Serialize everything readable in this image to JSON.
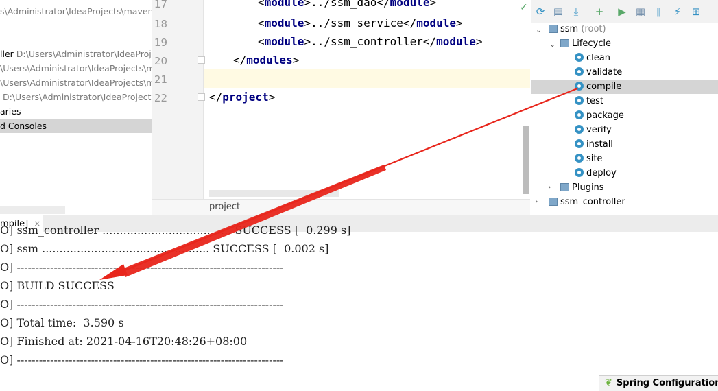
{
  "project_tree": [
    {
      "label": "",
      "path": "s\\Administrator\\IdeaProjects\\maven_a",
      "selected": false
    },
    {
      "label": "ller",
      "path": "D:\\Users\\Administrator\\IdeaProjec",
      "selected": false
    },
    {
      "label": "",
      "path": "\\Users\\Administrator\\IdeaProjects\\mav",
      "selected": false
    },
    {
      "label": "",
      "path": "\\Users\\Administrator\\IdeaProjects\\ma",
      "selected": false
    },
    {
      "label": "",
      "path": "D:\\Users\\Administrator\\IdeaProjects\\",
      "selected": false
    },
    {
      "label": "aries",
      "path": "",
      "selected": false
    },
    {
      "label": "d Consoles",
      "path": "",
      "selected": true
    }
  ],
  "editor": {
    "lines": [
      {
        "num": "17",
        "open": "<",
        "tag": "module",
        "mid": ">../ssm_dao</",
        "tag2": "module",
        "close": ">"
      },
      {
        "num": "18",
        "open": "<",
        "tag": "module",
        "mid": ">../ssm_service</",
        "tag2": "module",
        "close": ">"
      },
      {
        "num": "19",
        "open": "<",
        "tag": "module",
        "mid": ">../ssm_controller</",
        "tag2": "module",
        "close": ">"
      },
      {
        "num": "20",
        "open": "</",
        "tag": "modules",
        "mid": ">",
        "tag2": "",
        "close": ""
      },
      {
        "num": "21",
        "open": "",
        "tag": "",
        "mid": "",
        "tag2": "",
        "close": ""
      },
      {
        "num": "22",
        "open": "</",
        "tag": "project",
        "mid": ">",
        "tag2": "",
        "close": ""
      }
    ],
    "breadcrumb": "project"
  },
  "maven": {
    "root_label": "ssm",
    "root_suffix": "(root)",
    "lifecycle_label": "Lifecycle",
    "phases": [
      "clean",
      "validate",
      "compile",
      "test",
      "package",
      "verify",
      "install",
      "site",
      "deploy"
    ],
    "selected_phase": "compile",
    "plugins_label": "Plugins",
    "next_module": "ssm_controller"
  },
  "console": {
    "tab_label": "mpile]",
    "close_glyph": "×",
    "lines": [
      "O] ssm_controller ..................................... SUCCESS [  0.299 s]",
      "O] ssm ................................................ SUCCESS [  0.002 s]",
      "O] ------------------------------------------------------------------------",
      "O] BUILD SUCCESS",
      "O] ------------------------------------------------------------------------",
      "O] Total time:  3.590 s",
      "O] Finished at: 2021-04-16T20:48:26+08:00",
      "O] ------------------------------------------------------------------------"
    ]
  },
  "status": {
    "spring_label": "Spring Configuration C"
  },
  "colors": {
    "arrow": "#e8261c",
    "accent_green": "#59a869",
    "gear_blue": "#3592c4"
  }
}
